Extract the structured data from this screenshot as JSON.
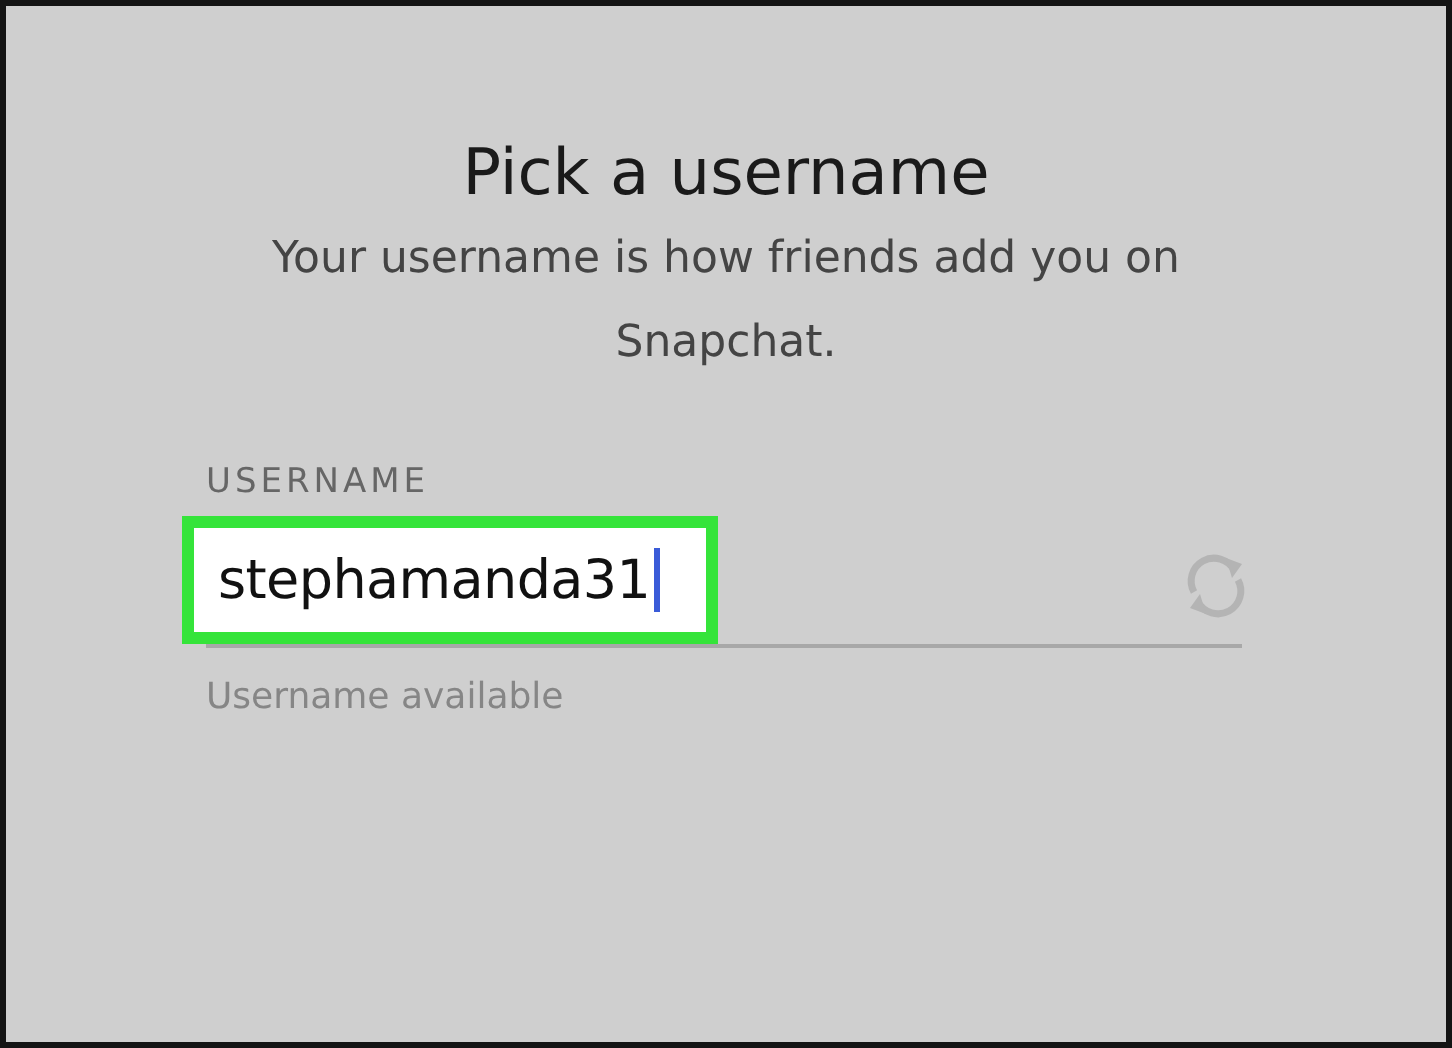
{
  "title": "Pick a username",
  "subtitle": "Your username is how friends add you on Snapchat.",
  "username_field": {
    "label": "USERNAME",
    "value": "stephamanda31",
    "focused": true,
    "highlighted": true
  },
  "status": "Username available"
}
